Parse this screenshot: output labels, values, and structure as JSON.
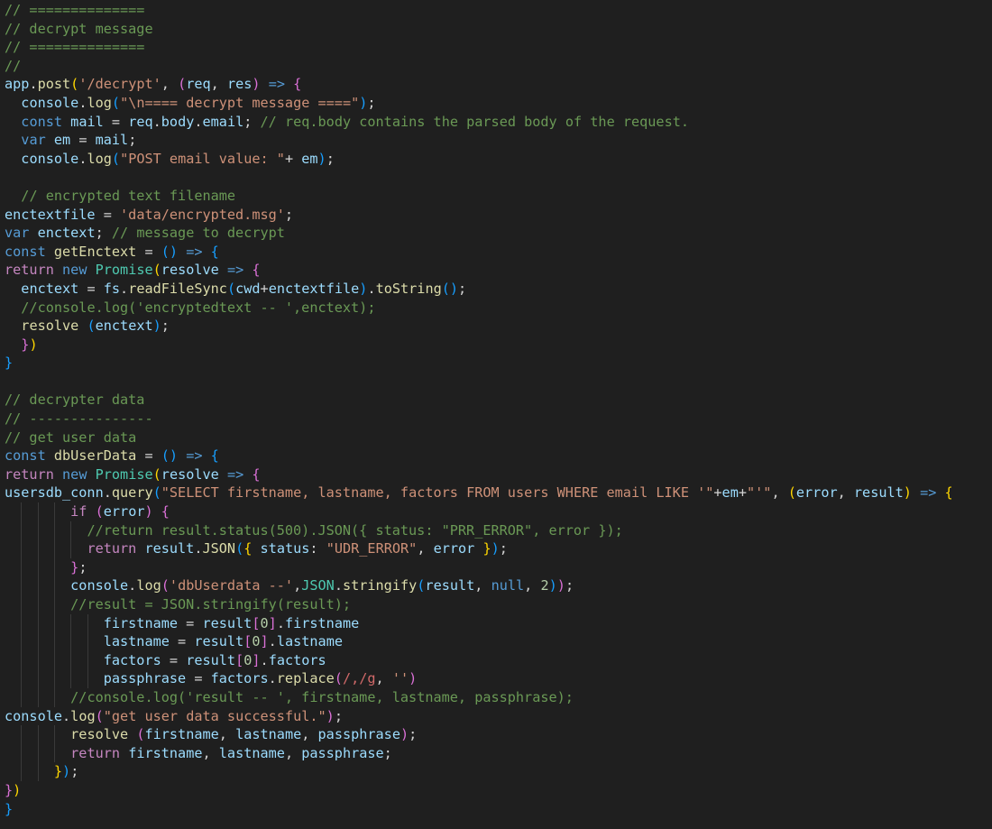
{
  "colors": {
    "background": "#1f1f1f",
    "default": "#d4d4d4",
    "comment": "#6a9955",
    "keyword": "#569cd6",
    "control": "#c586c0",
    "function": "#dcdcaa",
    "variable": "#9cdcfe",
    "string": "#ce9178",
    "number": "#b5cea8",
    "type": "#4ec9b0",
    "bracket1": "#ffd700",
    "bracket2": "#da70d6",
    "bracket3": "#179fff",
    "regex": "#d16969",
    "indent_guide": "#3a3a3a"
  },
  "lines": [
    [
      [
        "// ==============",
        "comment"
      ]
    ],
    [
      [
        "// decrypt message",
        "comment"
      ]
    ],
    [
      [
        "// ==============",
        "comment"
      ]
    ],
    [
      [
        "//",
        "comment"
      ]
    ],
    [
      [
        "app",
        "variable"
      ],
      [
        ".",
        "default"
      ],
      [
        "post",
        "function"
      ],
      [
        "(",
        "bracket1"
      ],
      [
        "'/decrypt'",
        "string"
      ],
      [
        ", ",
        "default"
      ],
      [
        "(",
        "bracket2"
      ],
      [
        "req",
        "variable"
      ],
      [
        ", ",
        "default"
      ],
      [
        "res",
        "variable"
      ],
      [
        ")",
        "bracket2"
      ],
      [
        " ",
        "default"
      ],
      [
        "=>",
        "keyword"
      ],
      [
        " ",
        "default"
      ],
      [
        "{",
        "bracket2"
      ]
    ],
    [
      [
        "  ",
        "default"
      ],
      [
        "console",
        "variable"
      ],
      [
        ".",
        "default"
      ],
      [
        "log",
        "function"
      ],
      [
        "(",
        "bracket3"
      ],
      [
        "\"\\n==== decrypt message ====\"",
        "string"
      ],
      [
        ")",
        "bracket3"
      ],
      [
        ";",
        "default"
      ]
    ],
    [
      [
        "  ",
        "default"
      ],
      [
        "const",
        "keyword"
      ],
      [
        " ",
        "default"
      ],
      [
        "mail",
        "variable"
      ],
      [
        " = ",
        "default"
      ],
      [
        "req",
        "variable"
      ],
      [
        ".",
        "default"
      ],
      [
        "body",
        "variable"
      ],
      [
        ".",
        "default"
      ],
      [
        "email",
        "variable"
      ],
      [
        "; ",
        "default"
      ],
      [
        "// req.body contains the parsed body of the request.",
        "comment"
      ]
    ],
    [
      [
        "  ",
        "default"
      ],
      [
        "var",
        "keyword"
      ],
      [
        " ",
        "default"
      ],
      [
        "em",
        "variable"
      ],
      [
        " = ",
        "default"
      ],
      [
        "mail",
        "variable"
      ],
      [
        ";",
        "default"
      ]
    ],
    [
      [
        "  ",
        "default"
      ],
      [
        "console",
        "variable"
      ],
      [
        ".",
        "default"
      ],
      [
        "log",
        "function"
      ],
      [
        "(",
        "bracket3"
      ],
      [
        "\"POST email value: \"",
        "string"
      ],
      [
        "+ ",
        "default"
      ],
      [
        "em",
        "variable"
      ],
      [
        ")",
        "bracket3"
      ],
      [
        ";",
        "default"
      ]
    ],
    [],
    [
      [
        "  ",
        "default"
      ],
      [
        "// encrypted text filename",
        "comment"
      ]
    ],
    [
      [
        "enctextfile",
        "variable"
      ],
      [
        " = ",
        "default"
      ],
      [
        "'data/encrypted.msg'",
        "string"
      ],
      [
        ";",
        "default"
      ]
    ],
    [
      [
        "var",
        "keyword"
      ],
      [
        " ",
        "default"
      ],
      [
        "enctext",
        "variable"
      ],
      [
        "; ",
        "default"
      ],
      [
        "// message to decrypt",
        "comment"
      ]
    ],
    [
      [
        "const",
        "keyword"
      ],
      [
        " ",
        "default"
      ],
      [
        "getEnctext",
        "function"
      ],
      [
        " = ",
        "default"
      ],
      [
        "()",
        "bracket3"
      ],
      [
        " ",
        "default"
      ],
      [
        "=>",
        "keyword"
      ],
      [
        " ",
        "default"
      ],
      [
        "{",
        "bracket3"
      ]
    ],
    [
      [
        "return",
        "control"
      ],
      [
        " ",
        "default"
      ],
      [
        "new",
        "keyword"
      ],
      [
        " ",
        "default"
      ],
      [
        "Promise",
        "type"
      ],
      [
        "(",
        "bracket1"
      ],
      [
        "resolve",
        "variable"
      ],
      [
        " ",
        "default"
      ],
      [
        "=>",
        "keyword"
      ],
      [
        " ",
        "default"
      ],
      [
        "{",
        "bracket2"
      ]
    ],
    [
      [
        "  ",
        "default"
      ],
      [
        "enctext",
        "variable"
      ],
      [
        " = ",
        "default"
      ],
      [
        "fs",
        "variable"
      ],
      [
        ".",
        "default"
      ],
      [
        "readFileSync",
        "function"
      ],
      [
        "(",
        "bracket3"
      ],
      [
        "cwd",
        "variable"
      ],
      [
        "+",
        "default"
      ],
      [
        "enctextfile",
        "variable"
      ],
      [
        ")",
        "bracket3"
      ],
      [
        ".",
        "default"
      ],
      [
        "toString",
        "function"
      ],
      [
        "()",
        "bracket3"
      ],
      [
        ";",
        "default"
      ]
    ],
    [
      [
        "  ",
        "default"
      ],
      [
        "//console.log('encryptedtext -- ',enctext);",
        "comment"
      ]
    ],
    [
      [
        "  ",
        "default"
      ],
      [
        "resolve",
        "function"
      ],
      [
        " ",
        "default"
      ],
      [
        "(",
        "bracket3"
      ],
      [
        "enctext",
        "variable"
      ],
      [
        ")",
        "bracket3"
      ],
      [
        ";",
        "default"
      ]
    ],
    [
      [
        "  ",
        "default"
      ],
      [
        "}",
        "bracket2"
      ],
      [
        ")",
        "bracket1"
      ]
    ],
    [
      [
        "}",
        "bracket3"
      ]
    ],
    [],
    [
      [
        "// decrypter data",
        "comment"
      ]
    ],
    [
      [
        "// ---------------",
        "comment"
      ]
    ],
    [
      [
        "// get user data",
        "comment"
      ]
    ],
    [
      [
        "const",
        "keyword"
      ],
      [
        " ",
        "default"
      ],
      [
        "dbUserData",
        "function"
      ],
      [
        " = ",
        "default"
      ],
      [
        "()",
        "bracket3"
      ],
      [
        " ",
        "default"
      ],
      [
        "=>",
        "keyword"
      ],
      [
        " ",
        "default"
      ],
      [
        "{",
        "bracket3"
      ]
    ],
    [
      [
        "return",
        "control"
      ],
      [
        " ",
        "default"
      ],
      [
        "new",
        "keyword"
      ],
      [
        " ",
        "default"
      ],
      [
        "Promise",
        "type"
      ],
      [
        "(",
        "bracket1"
      ],
      [
        "resolve",
        "variable"
      ],
      [
        " ",
        "default"
      ],
      [
        "=>",
        "keyword"
      ],
      [
        " ",
        "default"
      ],
      [
        "{",
        "bracket2"
      ]
    ],
    [
      [
        "usersdb_conn",
        "variable"
      ],
      [
        ".",
        "default"
      ],
      [
        "query",
        "function"
      ],
      [
        "(",
        "bracket3"
      ],
      [
        "\"SELECT firstname, lastname, factors FROM users WHERE email LIKE '\"",
        "string"
      ],
      [
        "+",
        "default"
      ],
      [
        "em",
        "variable"
      ],
      [
        "+",
        "default"
      ],
      [
        "\"'\"",
        "string"
      ],
      [
        ", ",
        "default"
      ],
      [
        "(",
        "bracket1"
      ],
      [
        "error",
        "variable"
      ],
      [
        ", ",
        "default"
      ],
      [
        "result",
        "variable"
      ],
      [
        ")",
        "bracket1"
      ],
      [
        " ",
        "default"
      ],
      [
        "=>",
        "keyword"
      ],
      [
        " ",
        "default"
      ],
      [
        "{",
        "bracket1"
      ]
    ],
    [
      [
        "        ",
        "default"
      ],
      [
        "if",
        "control"
      ],
      [
        " ",
        "default"
      ],
      [
        "(",
        "bracket2"
      ],
      [
        "error",
        "variable"
      ],
      [
        ")",
        "bracket2"
      ],
      [
        " ",
        "default"
      ],
      [
        "{",
        "bracket2"
      ]
    ],
    [
      [
        "          ",
        "default"
      ],
      [
        "//return result.status(500).JSON({ status: \"PRR_ERROR\", error });",
        "comment"
      ]
    ],
    [
      [
        "          ",
        "default"
      ],
      [
        "return",
        "control"
      ],
      [
        " ",
        "default"
      ],
      [
        "result",
        "variable"
      ],
      [
        ".",
        "default"
      ],
      [
        "JSON",
        "function"
      ],
      [
        "(",
        "bracket3"
      ],
      [
        "{",
        "bracket1"
      ],
      [
        " ",
        "default"
      ],
      [
        "status",
        "variable"
      ],
      [
        ": ",
        "default"
      ],
      [
        "\"UDR_ERROR\"",
        "string"
      ],
      [
        ", ",
        "default"
      ],
      [
        "error",
        "variable"
      ],
      [
        " ",
        "default"
      ],
      [
        "}",
        "bracket1"
      ],
      [
        ")",
        "bracket3"
      ],
      [
        ";",
        "default"
      ]
    ],
    [
      [
        "        ",
        "default"
      ],
      [
        "}",
        "bracket2"
      ],
      [
        ";",
        "default"
      ]
    ],
    [
      [
        "        ",
        "default"
      ],
      [
        "console",
        "variable"
      ],
      [
        ".",
        "default"
      ],
      [
        "log",
        "function"
      ],
      [
        "(",
        "bracket2"
      ],
      [
        "'dbUserdata --'",
        "string"
      ],
      [
        ",",
        "default"
      ],
      [
        "JSON",
        "type"
      ],
      [
        ".",
        "default"
      ],
      [
        "stringify",
        "function"
      ],
      [
        "(",
        "bracket3"
      ],
      [
        "result",
        "variable"
      ],
      [
        ", ",
        "default"
      ],
      [
        "null",
        "keyword"
      ],
      [
        ", ",
        "default"
      ],
      [
        "2",
        "number"
      ],
      [
        ")",
        "bracket3"
      ],
      [
        ")",
        "bracket2"
      ],
      [
        ";",
        "default"
      ]
    ],
    [
      [
        "        ",
        "default"
      ],
      [
        "//result = JSON.stringify(result);",
        "comment"
      ]
    ],
    [
      [
        "            ",
        "default"
      ],
      [
        "firstname",
        "variable"
      ],
      [
        " = ",
        "default"
      ],
      [
        "result",
        "variable"
      ],
      [
        "[",
        "bracket2"
      ],
      [
        "0",
        "number"
      ],
      [
        "]",
        "bracket2"
      ],
      [
        ".",
        "default"
      ],
      [
        "firstname",
        "variable"
      ]
    ],
    [
      [
        "            ",
        "default"
      ],
      [
        "lastname",
        "variable"
      ],
      [
        " = ",
        "default"
      ],
      [
        "result",
        "variable"
      ],
      [
        "[",
        "bracket2"
      ],
      [
        "0",
        "number"
      ],
      [
        "]",
        "bracket2"
      ],
      [
        ".",
        "default"
      ],
      [
        "lastname",
        "variable"
      ]
    ],
    [
      [
        "            ",
        "default"
      ],
      [
        "factors",
        "variable"
      ],
      [
        " = ",
        "default"
      ],
      [
        "result",
        "variable"
      ],
      [
        "[",
        "bracket2"
      ],
      [
        "0",
        "number"
      ],
      [
        "]",
        "bracket2"
      ],
      [
        ".",
        "default"
      ],
      [
        "factors",
        "variable"
      ]
    ],
    [
      [
        "            ",
        "default"
      ],
      [
        "passphrase",
        "variable"
      ],
      [
        " = ",
        "default"
      ],
      [
        "factors",
        "variable"
      ],
      [
        ".",
        "default"
      ],
      [
        "replace",
        "function"
      ],
      [
        "(",
        "bracket2"
      ],
      [
        "/,/g",
        "regex"
      ],
      [
        ", ",
        "default"
      ],
      [
        "''",
        "string"
      ],
      [
        ")",
        "bracket2"
      ]
    ],
    [
      [
        "        ",
        "default"
      ],
      [
        "//console.log('result -- ', firstname, lastname, passphrase);",
        "comment"
      ]
    ],
    [
      [
        "console",
        "variable"
      ],
      [
        ".",
        "default"
      ],
      [
        "log",
        "function"
      ],
      [
        "(",
        "bracket2"
      ],
      [
        "\"get user data successful.\"",
        "string"
      ],
      [
        ")",
        "bracket2"
      ],
      [
        ";",
        "default"
      ]
    ],
    [
      [
        "        ",
        "default"
      ],
      [
        "resolve",
        "function"
      ],
      [
        " ",
        "default"
      ],
      [
        "(",
        "bracket2"
      ],
      [
        "firstname",
        "variable"
      ],
      [
        ", ",
        "default"
      ],
      [
        "lastname",
        "variable"
      ],
      [
        ", ",
        "default"
      ],
      [
        "passphrase",
        "variable"
      ],
      [
        ")",
        "bracket2"
      ],
      [
        ";",
        "default"
      ]
    ],
    [
      [
        "        ",
        "default"
      ],
      [
        "return",
        "control"
      ],
      [
        " ",
        "default"
      ],
      [
        "firstname",
        "variable"
      ],
      [
        ", ",
        "default"
      ],
      [
        "lastname",
        "variable"
      ],
      [
        ", ",
        "default"
      ],
      [
        "passphrase",
        "variable"
      ],
      [
        ";",
        "default"
      ]
    ],
    [
      [
        "      ",
        "default"
      ],
      [
        "}",
        "bracket1"
      ],
      [
        ")",
        "bracket3"
      ],
      [
        ";",
        "default"
      ]
    ],
    [
      [
        "}",
        "bracket2"
      ],
      [
        ")",
        "bracket1"
      ]
    ],
    [
      [
        "}",
        "bracket3"
      ]
    ]
  ]
}
